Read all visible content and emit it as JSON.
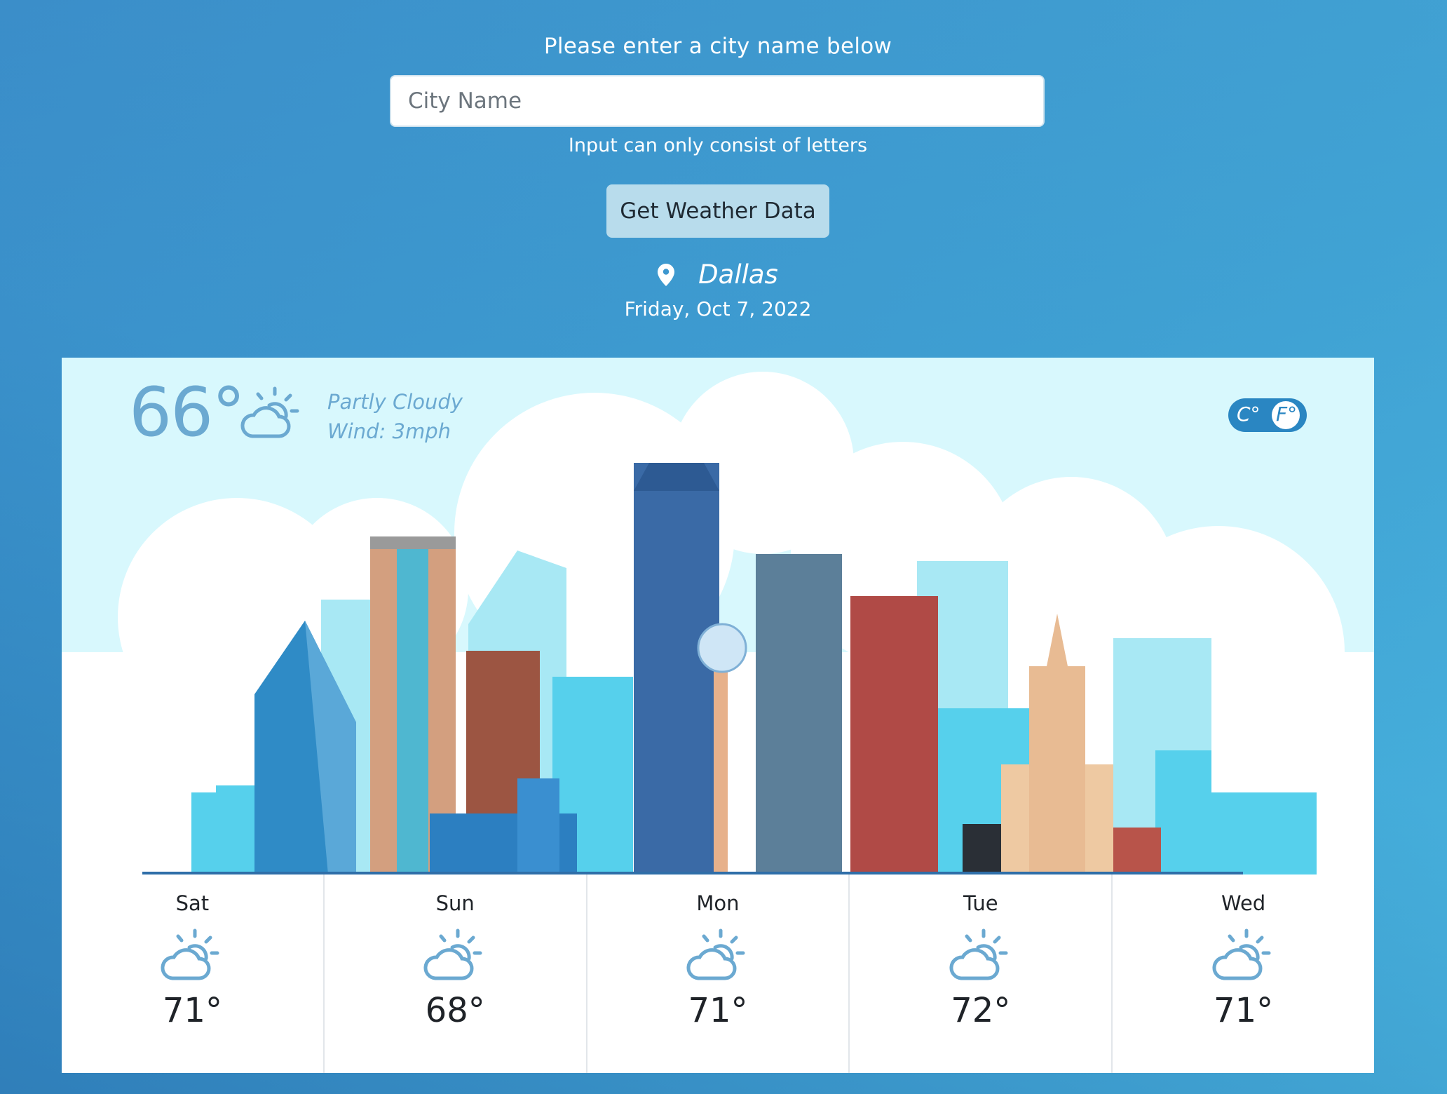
{
  "search": {
    "prompt": "Please enter a city name below",
    "placeholder": "City Name",
    "value": "",
    "hint": "Input can only consist of letters",
    "button_label": "Get Weather Data"
  },
  "location": {
    "city": "Dallas",
    "date": "Friday, Oct 7, 2022",
    "icon": "map-pin-icon"
  },
  "current": {
    "temperature": "66°",
    "condition": "Partly Cloudy",
    "wind": "Wind: 3mph",
    "icon": "partly-cloudy-icon"
  },
  "units": {
    "celsius_label": "C°",
    "fahrenheit_label": "F°",
    "selected": "F"
  },
  "forecast": [
    {
      "day": "Sat",
      "temp": "71°",
      "icon": "partly-cloudy-icon"
    },
    {
      "day": "Sun",
      "temp": "68°",
      "icon": "partly-cloudy-icon"
    },
    {
      "day": "Mon",
      "temp": "71°",
      "icon": "partly-cloudy-icon"
    },
    {
      "day": "Tue",
      "temp": "72°",
      "icon": "partly-cloudy-icon"
    },
    {
      "day": "Wed",
      "temp": "71°",
      "icon": "partly-cloudy-icon"
    }
  ],
  "colors": {
    "background": "#3f9fd2",
    "sky": "#d8f8fd",
    "accent": "#6ba9d1",
    "toggle": "#2a86c2",
    "button": "#b8dcec"
  }
}
